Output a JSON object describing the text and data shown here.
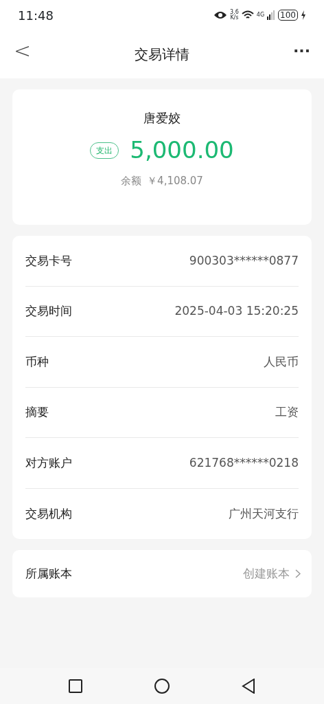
{
  "status_bar": {
    "time": "11:48",
    "speed": "3.6",
    "speed_unit": "K/s",
    "network": "4G",
    "battery": "100"
  },
  "header": {
    "title": "交易详情",
    "back": "<",
    "more": "···"
  },
  "summary": {
    "name": "唐爱姣",
    "type_tag": "支出",
    "amount": "5,000.00",
    "balance_label": "余额",
    "balance": "￥4,108.07"
  },
  "details": [
    {
      "label": "交易卡号",
      "value": "900303******0877"
    },
    {
      "label": "交易时间",
      "value": "2025-04-03 15:20:25"
    },
    {
      "label": "币种",
      "value": "人民币"
    },
    {
      "label": "摘要",
      "value": "工资"
    },
    {
      "label": "对方账户",
      "value": "621768******0218"
    },
    {
      "label": "交易机构",
      "value": "广州天河支行"
    }
  ],
  "ledger": {
    "label": "所属账本",
    "value": "创建账本"
  }
}
